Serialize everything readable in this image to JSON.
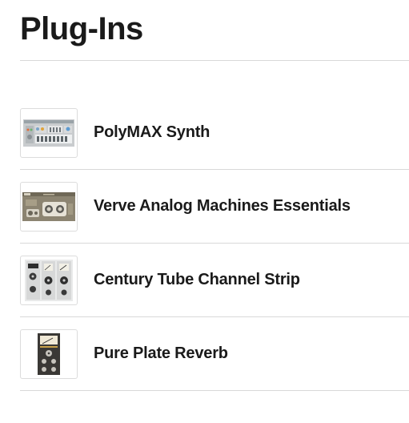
{
  "page": {
    "title": "Plug-Ins"
  },
  "plugins": [
    {
      "name": "PolyMAX Synth",
      "thumbnail_icon": "polymax-synth-thumbnail"
    },
    {
      "name": "Verve Analog Machines Essentials",
      "thumbnail_icon": "verve-analog-machines-thumbnail"
    },
    {
      "name": "Century Tube Channel Strip",
      "thumbnail_icon": "century-tube-channel-strip-thumbnail"
    },
    {
      "name": "Pure Plate Reverb",
      "thumbnail_icon": "pure-plate-reverb-thumbnail"
    }
  ],
  "colors": {
    "text": "#1a1a1a",
    "divider": "#d8d8d8",
    "thumbnail_border": "#dcdcdc"
  }
}
